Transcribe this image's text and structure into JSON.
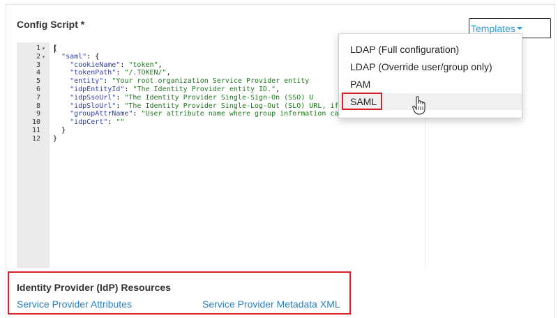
{
  "section_title": "Config Script",
  "required_mark": "*",
  "templates_button_label": "Templates",
  "dropdown_items": [
    "LDAP (Full configuration)",
    "LDAP (Override user/group only)",
    "PAM",
    "SAML"
  ],
  "code_lines": [
    {
      "n": "1",
      "fold": true,
      "html": "{"
    },
    {
      "n": "2",
      "fold": true,
      "html": "  <span class='key'>\"saml\"</span>: {"
    },
    {
      "n": "3",
      "fold": false,
      "html": "    <span class='key'>\"cookieName\"</span>: <span class='str'>\"token\"</span>,"
    },
    {
      "n": "4",
      "fold": false,
      "html": "    <span class='key'>\"tokenPath\"</span>: <span class='str'>\"/.TOKEN/\"</span>,"
    },
    {
      "n": "5",
      "fold": false,
      "html": "    <span class='key'>\"entity\"</span>: <span class='str'>\"Your root organization Service Provider entity</span>"
    },
    {
      "n": "6",
      "fold": false,
      "html": "    <span class='key'>\"idpEntityId\"</span>: <span class='str'>\"The Identity Provider entity ID.\"</span>,"
    },
    {
      "n": "7",
      "fold": false,
      "html": "    <span class='key'>\"idpSsoUrl\"</span>: <span class='str'>\"The Identity Provider Single-Sign-On (SSO) U</span>"
    },
    {
      "n": "8",
      "fold": false,
      "html": "    <span class='key'>\"idpSloUrl\"</span>: <span class='str'>\"The Identity Provider Single-Log-Out (SLO) URL, if applicable.\"</span>,"
    },
    {
      "n": "9",
      "fold": false,
      "html": "    <span class='key'>\"groupAttrName\"</span>: <span class='str'>\"User attribute name where group information can be found, if applicable.\"</span>,"
    },
    {
      "n": "10",
      "fold": false,
      "html": "    <span class='key'>\"idpCert\"</span>: <span class='str'>\"\"</span>"
    },
    {
      "n": "11",
      "fold": false,
      "html": "  }"
    },
    {
      "n": "12",
      "fold": false,
      "html": "}"
    }
  ],
  "idp_section_title": "Identity Provider (IdP) Resources",
  "links": [
    "Service Provider Attributes",
    "Service Provider Metadata XML"
  ]
}
